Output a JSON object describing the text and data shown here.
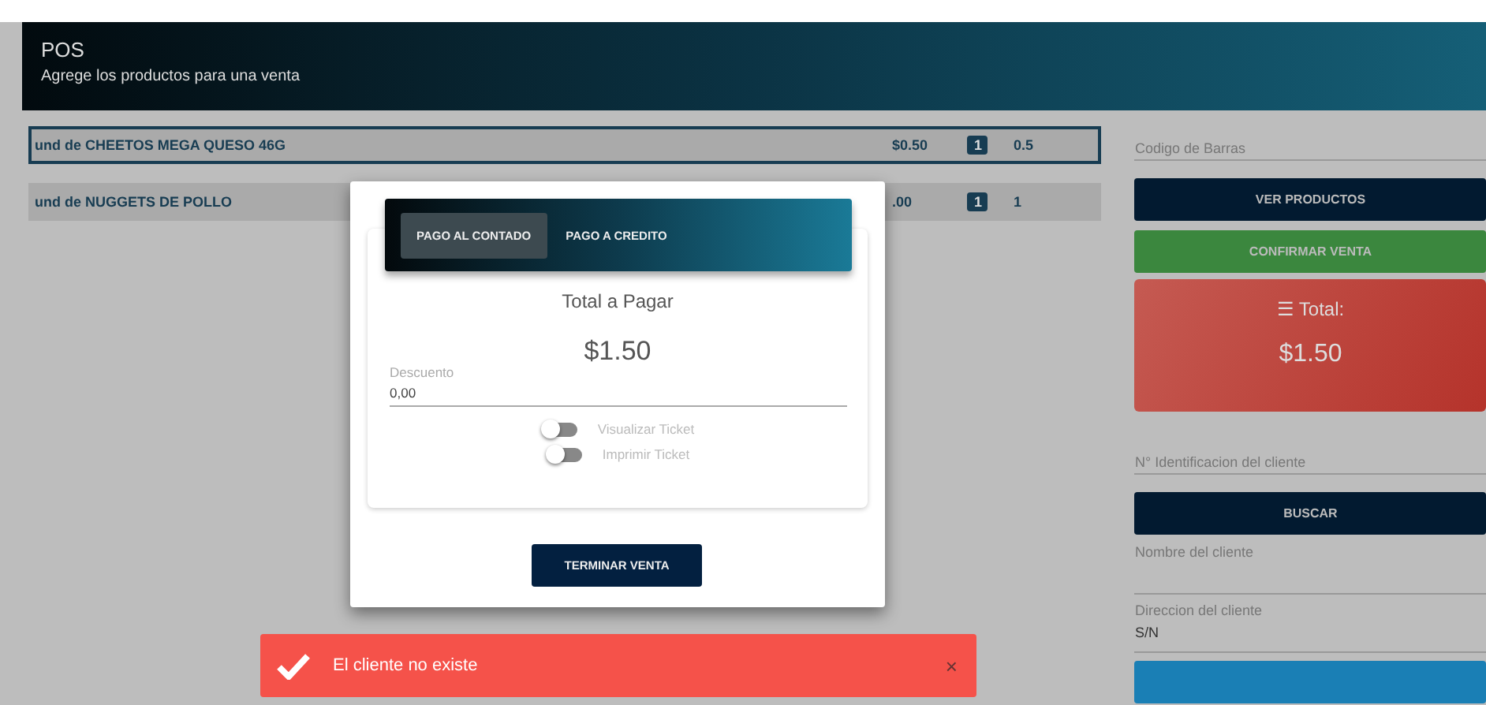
{
  "header": {
    "title": "POS",
    "subtitle": "Agrege los productos para una venta"
  },
  "products": [
    {
      "name": "und de CHEETOS MEGA QUESO 46G",
      "price": "$0.50",
      "qty": "1",
      "subtotal": "0.5",
      "selected": true
    },
    {
      "name": "und de NUGGETS DE POLLO",
      "price": ".00",
      "qty": "1",
      "subtotal": "1",
      "selected": false
    }
  ],
  "side": [
    {
      "kind": "field",
      "placeholder": "Codigo de Barras"
    },
    {
      "kind": "button",
      "label": "VER PRODUCTOS",
      "color": "#021a30"
    },
    {
      "kind": "button",
      "label": "CONFIRMAR VENTA",
      "color": "#3b873e"
    },
    {
      "kind": "total",
      "icon": "☰",
      "label": "Total:",
      "amount": "$1.50"
    },
    {
      "kind": "field",
      "placeholder": "N° Identificacion del cliente"
    },
    {
      "kind": "button",
      "label": "BUSCAR",
      "color": "#021a30"
    },
    {
      "kind": "labeled",
      "label": "Nombre del cliente"
    },
    {
      "kind": "labeled",
      "label": "Direccion del cliente",
      "value": "S/N"
    },
    {
      "kind": "button",
      "color": "#1a7fb5"
    }
  ],
  "modal": {
    "tabs": [
      {
        "label": "PAGO AL CONTADO",
        "selected": true
      },
      {
        "label": "PAGO A CREDITO",
        "selected": false
      }
    ],
    "total_label": "Total a Pagar",
    "total": "$1.50",
    "discount": {
      "label": "Descuento",
      "value": "0,00"
    },
    "toggles": [
      {
        "label": "Visualizar Ticket",
        "on": false
      },
      {
        "label": "Imprimir Ticket",
        "on": false
      }
    ],
    "button": "TERMINAR VENTA"
  },
  "toast": {
    "message": "El cliente no existe",
    "close": "×"
  }
}
